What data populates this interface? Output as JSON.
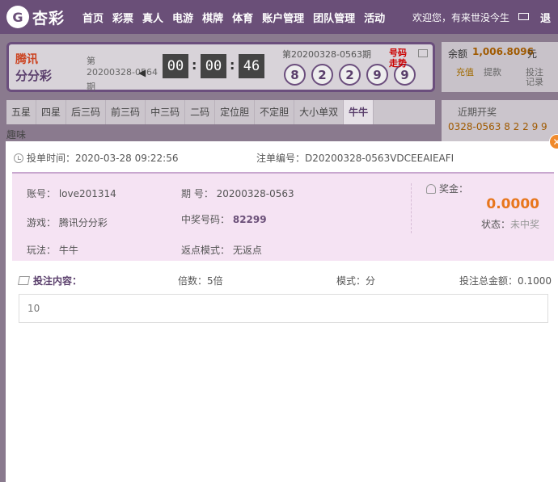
{
  "topbar": {
    "logo_mark": "G",
    "logo_text": "杏彩",
    "nav": [
      "首页",
      "彩票",
      "真人",
      "电游",
      "棋牌",
      "体育",
      "账户管理",
      "团队管理",
      "活动"
    ],
    "welcome": "欢迎您，有来世没今生",
    "exit": "退"
  },
  "lottery": {
    "logo_top": "腾讯",
    "logo_bottom": "分分彩",
    "period_prefix": "第",
    "period_current": "20200328-0564",
    "period_suffix": "期",
    "timer": [
      "00",
      "00",
      "46"
    ],
    "last_period": "第20200328-0563期",
    "balls": [
      "8",
      "2",
      "2",
      "9",
      "9"
    ],
    "trend_link": "号码走势"
  },
  "balance": {
    "label": "余额",
    "value": "1,006.8096",
    "unit": "元",
    "actions": [
      "充值",
      "提款",
      "投注记录"
    ]
  },
  "tabs": [
    "五星",
    "四星",
    "后三码",
    "前三码",
    "中三码",
    "二码",
    "定位胆",
    "不定胆",
    "大小单双",
    "牛牛"
  ],
  "tabs_second_row": "趣味",
  "recent": {
    "title": "近期开奖",
    "line": "0328-0563  8 2 2 9 9"
  },
  "modal": {
    "bet_time_label": "投单时间：",
    "bet_time": "2020-03-28 09:22:56",
    "order_label": "注单编号：",
    "order_id": "D20200328-0563VDCEEAIEAFI",
    "account_label": "账号：",
    "account": "love201314",
    "period_label": "期 号：",
    "period": "20200328-0563",
    "game_label": "游戏：",
    "game": "腾讯分分彩",
    "win_no_label": "中奖号码：",
    "win_no": "82299",
    "play_label": "玩法：",
    "play": "牛牛",
    "rebate_label": "返点模式：",
    "rebate": "无返点",
    "bonus_label": "奖金：",
    "bonus": "0.0000",
    "status_label": "状态：",
    "status": "未中奖",
    "content_label": "投注内容：",
    "multiple": "倍数：5倍",
    "mode": "模式：分",
    "total": "投注总金额：0.1000",
    "content": "10"
  }
}
